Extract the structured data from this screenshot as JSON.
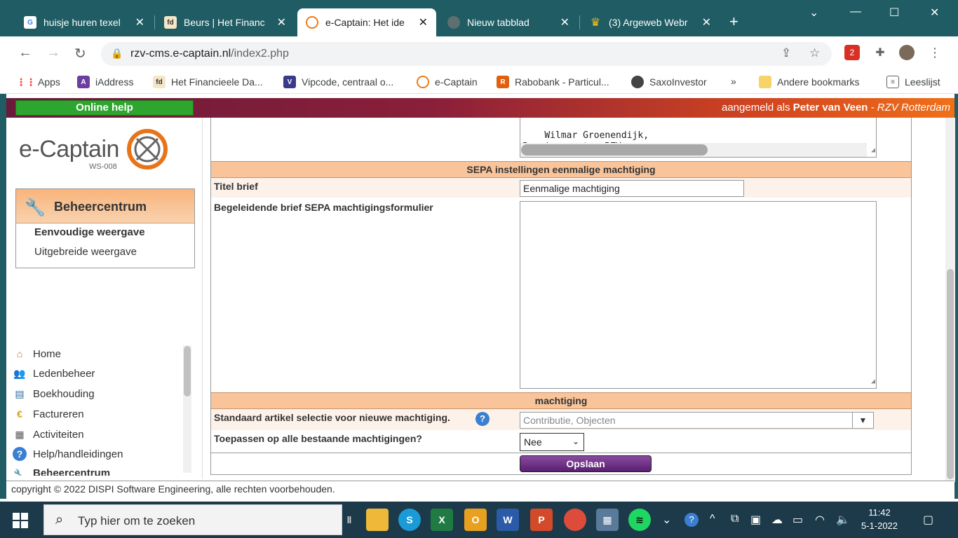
{
  "browser": {
    "tabs": [
      {
        "label": "huisje huren texel",
        "active": false,
        "icon": "google-icon"
      },
      {
        "label": "Beurs | Het Financ",
        "active": false,
        "icon": "fd-icon"
      },
      {
        "label": "e-Captain: Het ide",
        "active": true,
        "icon": "ecaptain-icon"
      },
      {
        "label": "Nieuw tabblad",
        "active": false,
        "icon": "chrome-icon"
      },
      {
        "label": "(3) Argeweb Webr",
        "active": false,
        "icon": "crown-icon"
      }
    ],
    "url_host": "rzv-cms.e-captain.nl",
    "url_path": "/index2.php",
    "ext_badge": "2",
    "bookmarks": [
      {
        "label": "Apps",
        "color": "#ea4335"
      },
      {
        "label": "iAddress",
        "color": "#6b3fa0"
      },
      {
        "label": "Het Financieele Da...",
        "color": "#f5e6c8"
      },
      {
        "label": "Vipcode, centraal o...",
        "color": "#3a3a8a"
      },
      {
        "label": "e-Captain",
        "color": "#ef7b1a"
      },
      {
        "label": "Rabobank - Particul...",
        "color": "#e06010"
      },
      {
        "label": "SaxoInvestor",
        "color": "#444444"
      }
    ],
    "bookmarks_overflow": "»",
    "other_bookmarks": "Andere bookmarks",
    "reading_list": "Leeslijst"
  },
  "app": {
    "online_help": "Online help",
    "logged_in_prefix": "aangemeld als ",
    "user_name": "Peter van Veen",
    "org": " - RZV Rotterdam",
    "logo_text": "e-Captain",
    "logo_sub": "WS-008",
    "beheer_title": "Beheercentrum",
    "beheer_simple": "Eenvoudige weergave",
    "beheer_extended": "Uitgebreide weergave",
    "menu": [
      {
        "label": "Home",
        "icon": "home-icon"
      },
      {
        "label": "Ledenbeheer",
        "icon": "users-icon"
      },
      {
        "label": "Boekhouding",
        "icon": "ledger-icon"
      },
      {
        "label": "Factureren",
        "icon": "euro-icon"
      },
      {
        "label": "Activiteiten",
        "icon": "calendar-icon"
      },
      {
        "label": "Help/handleidingen",
        "icon": "help-icon"
      },
      {
        "label": "Beheercentrum",
        "icon": "wrench-icon"
      }
    ],
    "footer": "copyright © 2022 DISPI Software Engineering, alle rechten voorbehouden."
  },
  "form": {
    "signature_text": "Wilmar Groenendijk,\nPenningmeester RZV.",
    "section_sepa": "SEPA instellingen eenmalige machtiging",
    "titel_label": "Titel brief",
    "titel_value": "Eenmalige machtiging",
    "begeleidende_label": "Begeleidende brief SEPA machtigingsformulier",
    "begeleidende_value": "",
    "section_machtiging": "machtiging",
    "standaard_label": "Standaard artikel selectie voor nieuwe machtiging.",
    "standaard_placeholder": "Contributie, Objecten",
    "toepassen_label": "Toepassen op alle bestaande machtigingen?",
    "toepassen_value": "Nee",
    "save_label": "Opslaan"
  },
  "taskbar": {
    "search_placeholder": "Typ hier om te zoeken",
    "time": "11:42",
    "date": "5-1-2022"
  }
}
